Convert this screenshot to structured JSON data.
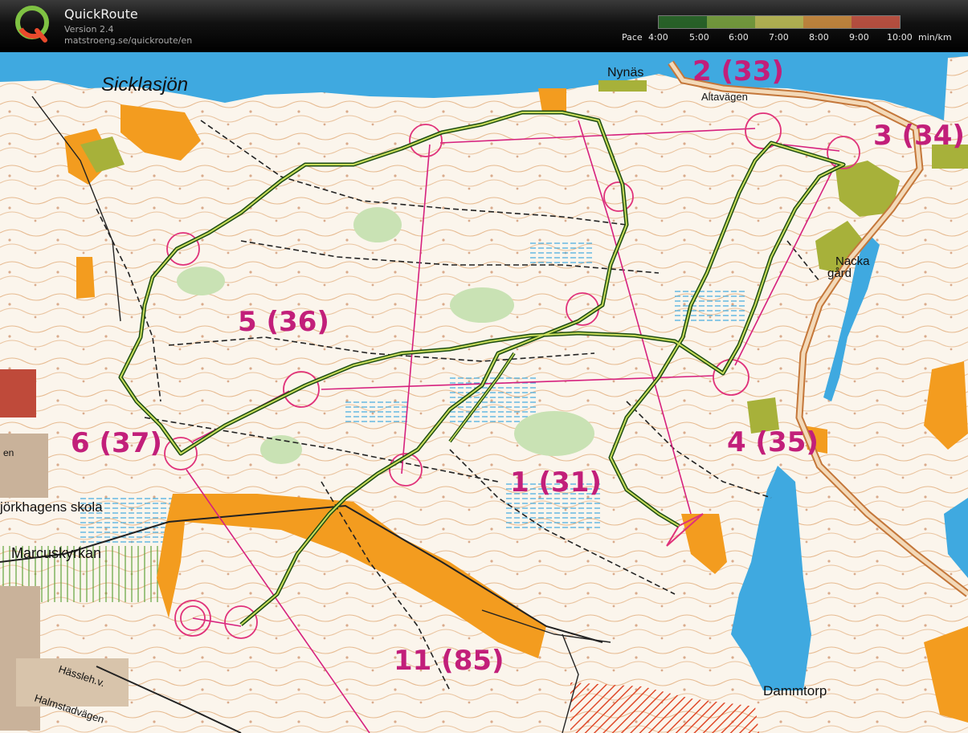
{
  "app": {
    "title": "QuickRoute",
    "version": "Version 2.4",
    "url": "matstroeng.se/quickroute/en"
  },
  "pace_legend": {
    "label": "Pace",
    "ticks": [
      "4:00",
      "5:00",
      "6:00",
      "7:00",
      "8:00",
      "9:00",
      "10:00"
    ],
    "unit": "min/km",
    "colors": [
      "#2f7a2f",
      "#8fc04a",
      "#e2e065",
      "#f1a64a",
      "#e8624e"
    ]
  },
  "map": {
    "controls": {
      "c1": "1 (31)",
      "c2": "2 (33)",
      "c3": "3 (34)",
      "c4": "4 (35)",
      "c5": "5 (36)",
      "c6": "6 (37)",
      "c11": "11 (85)"
    },
    "places": {
      "sicklasjon": "Sicklasjön",
      "nynas": "Nynäs",
      "altavagen": "Altavägen",
      "nacka": "Nacka",
      "gard": "gård",
      "bjorkhagens": "jörkhagens skola",
      "marcuskyrkan": "Marcuskyrkan",
      "hassleh": "Hässleh.v.",
      "halmstad": "Halmstadvägen",
      "dammtorp": "Dammtorp",
      "en": "en"
    },
    "colors": {
      "water": "#3fa9e0",
      "route": "#2e6b1f",
      "course": "#d6217e",
      "contour": "#c9742c",
      "open": "#f39c1f",
      "green": "#8cb03a"
    }
  }
}
